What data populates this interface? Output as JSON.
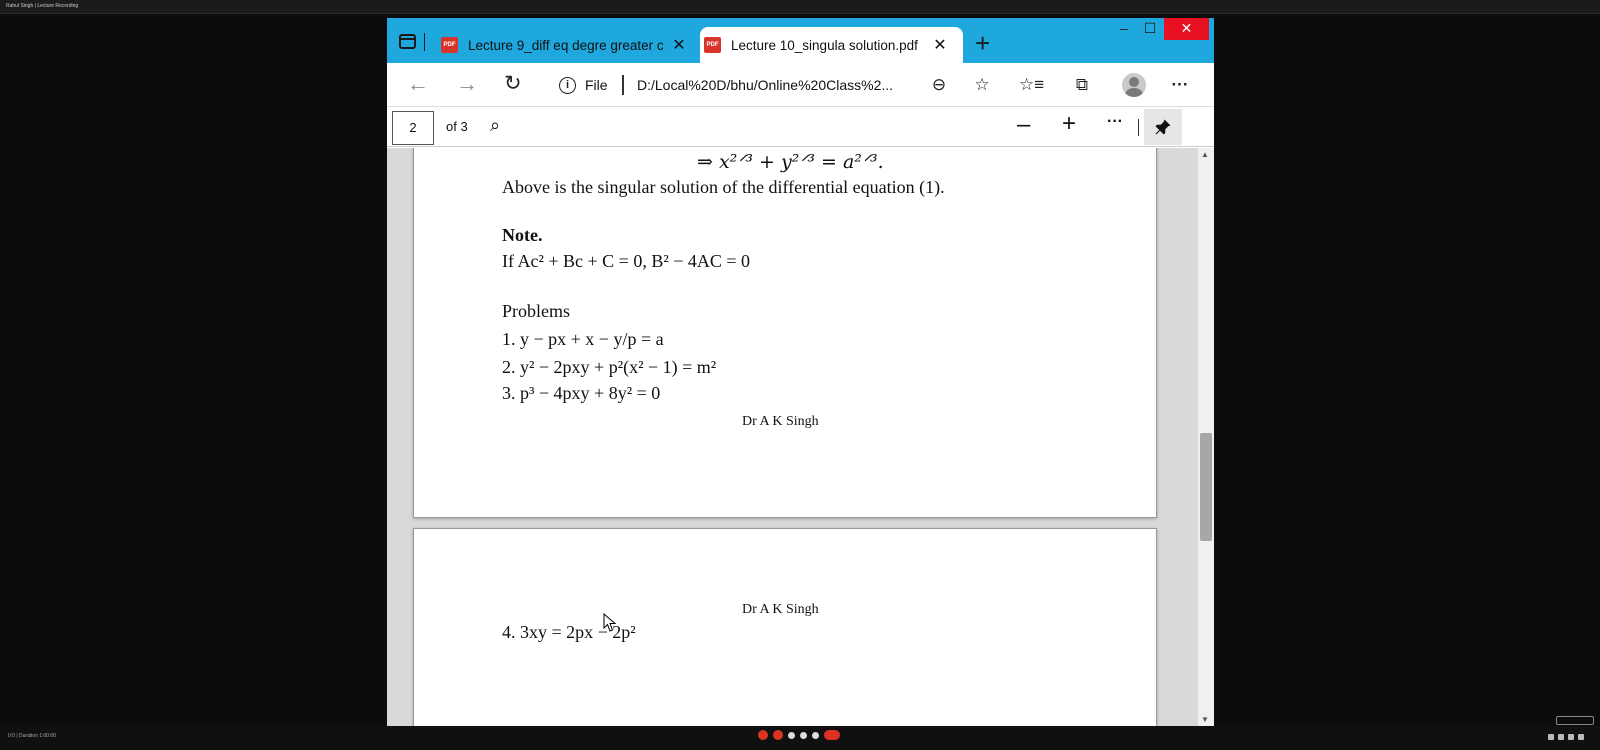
{
  "outer": {
    "title": "Rahul Singh | Lecture Recording",
    "bottom_left": "0:0  |  Duration 1:00:00"
  },
  "browser": {
    "tabs": [
      {
        "label": "Lecture 9_diff eq degre greater c",
        "icon": "pdf-icon",
        "active": false
      },
      {
        "label": "Lecture 10_singula solution.pdf",
        "icon": "pdf-icon",
        "active": true
      }
    ],
    "new_tab": "+",
    "window": {
      "minimize": "–",
      "maximize": "☐",
      "close": "✕"
    },
    "nav": {
      "back": "←",
      "forward": "→",
      "reload": "↻"
    },
    "address": {
      "info": "i",
      "file_label": "File",
      "url": "D:/Local%20D/bhu/Online%20Class%2..."
    },
    "toolbar_icons": [
      "zoom-icon",
      "add-favorite-icon",
      "favorites-icon",
      "collections-icon",
      "profile-icon",
      "more-icon"
    ]
  },
  "pdf_toolbar": {
    "page_number": "2",
    "page_total": "of 3",
    "zoom_out": "–",
    "zoom_in": "+",
    "more": "···",
    "pin": "📌"
  },
  "document": {
    "page1": {
      "equation_top": "⇒ x²ᐟ³ + y²ᐟ³ = a²ᐟ³.",
      "sentence": "Above is the singular solution of the differential equation (1).",
      "note_heading": "Note.",
      "note_text": "If Ac² + Bc + C = 0, B² − 4AC = 0",
      "problems_heading": "Problems",
      "problem_1": "1. y − px + x − y/p = a",
      "problem_2": "2. y² − 2pxy + p²(x² − 1) = m²",
      "problem_3": "3. p³ − 4pxy + 8y² = 0",
      "author": "Dr A K Singh"
    },
    "page2": {
      "author": "Dr A K Singh",
      "problem_4": "4. 3xy = 2px − 2p²"
    }
  }
}
